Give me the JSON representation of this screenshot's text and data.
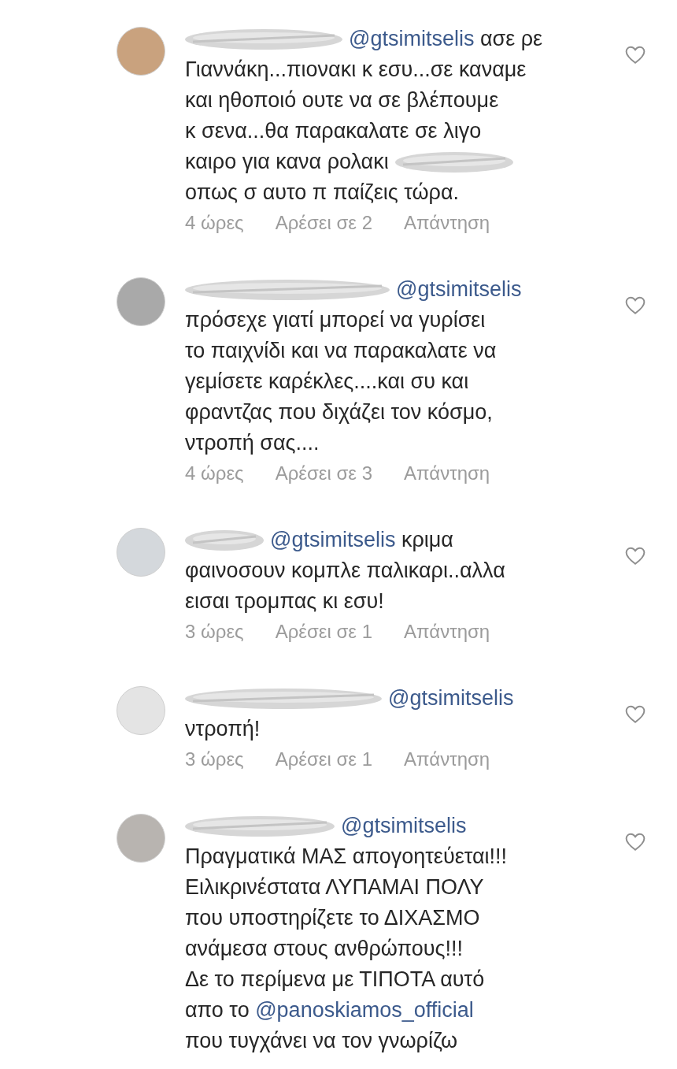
{
  "comments": [
    {
      "avatar": {
        "color": "#c9a27e"
      },
      "liked": false,
      "lines": [
        [
          {
            "kind": "redacted"
          },
          {
            "kind": "mention",
            "text": "@gtsimitselis"
          },
          {
            "kind": "text",
            "text": " ασε ρε"
          }
        ],
        [
          {
            "kind": "text",
            "text": "Γιαννάκη...πιονακι  κ εσυ...σε καναμε"
          }
        ],
        [
          {
            "kind": "text",
            "text": "και ηθοποιό  ουτε  να σε βλέπουμε"
          }
        ],
        [
          {
            "kind": "text",
            "text": "κ σενα...θα παρακαλατε  σε λιγο"
          }
        ],
        [
          {
            "kind": "text",
            "text": "καιρο  για κανα  ρολακι"
          },
          {
            "kind": "redacted"
          }
        ],
        [
          {
            "kind": "text",
            "text": "οπως  σ αυτο  π παίζεις  τώρα."
          }
        ]
      ],
      "time": "4 ώρες",
      "likes": "Αρέσει σε 2",
      "reply": "Απάντηση"
    },
    {
      "avatar": {
        "color": "#a9a9a9"
      },
      "liked": false,
      "lines": [
        [
          {
            "kind": "redacted"
          },
          {
            "kind": "mention",
            "text": "@gtsimitselis"
          }
        ],
        [
          {
            "kind": "text",
            "text": "πρόσεχε γιατί  μπορεί να γυρίσει"
          }
        ],
        [
          {
            "kind": "text",
            "text": "το παιχνίδι και να παρακαλατε  να"
          }
        ],
        [
          {
            "kind": "text",
            "text": "γεμίσετε καρέκλες....και συ και"
          }
        ],
        [
          {
            "kind": "text",
            "text": "φραντζας που διχάζει τον κόσμο,"
          }
        ],
        [
          {
            "kind": "text",
            "text": "ντροπή σας...."
          }
        ]
      ],
      "time": "4 ώρες",
      "likes": "Αρέσει σε 3",
      "reply": "Απάντηση"
    },
    {
      "avatar": {
        "color": "#d4d8dc"
      },
      "liked": false,
      "lines": [
        [
          {
            "kind": "redacted"
          },
          {
            "kind": "mention",
            "text": "@gtsimitselis"
          },
          {
            "kind": "text",
            "text": " κριμα"
          }
        ],
        [
          {
            "kind": "text",
            "text": "φαινοσουν κομπλε παλικαρι..αλλα"
          }
        ],
        [
          {
            "kind": "text",
            "text": "εισαι τρομπας κι εσυ!"
          }
        ]
      ],
      "time": "3 ώρες",
      "likes": "Αρέσει σε 1",
      "reply": "Απάντηση"
    },
    {
      "avatar": {
        "color": "#e4e4e4"
      },
      "liked": false,
      "lines": [
        [
          {
            "kind": "redacted"
          },
          {
            "kind": "mention",
            "text": "@gtsimitselis"
          }
        ],
        [
          {
            "kind": "text",
            "text": "ντροπή!"
          }
        ]
      ],
      "time": "3 ώρες",
      "likes": "Αρέσει σε 1",
      "reply": "Απάντηση"
    },
    {
      "avatar": {
        "color": "#b8b4b0"
      },
      "liked": false,
      "lines": [
        [
          {
            "kind": "redacted"
          },
          {
            "kind": "mention",
            "text": "@gtsimitselis"
          }
        ],
        [
          {
            "kind": "text",
            "text": "Πραγματικά ΜΑΣ απογοητεύεται!!!"
          }
        ],
        [
          {
            "kind": "text",
            "text": "Ειλικρινέστατα ΛΥΠΑΜΑΙ ΠΟΛΥ"
          }
        ],
        [
          {
            "kind": "text",
            "text": "που υποστηρίζετε το ΔΙΧΑΣΜΟ"
          }
        ],
        [
          {
            "kind": "text",
            "text": "ανάμεσα στους ανθρώπους!!!"
          }
        ],
        [
          {
            "kind": "text",
            "text": "Δε το περίμενα με ΤΙΠΟΤΑ αυτό"
          }
        ],
        [
          {
            "kind": "text",
            "text": "απο το "
          },
          {
            "kind": "mention",
            "text": "@panoskiamos_official"
          }
        ],
        [
          {
            "kind": "text",
            "text": "που τυγχάνει να τον γνωρίζω"
          }
        ]
      ]
    }
  ]
}
